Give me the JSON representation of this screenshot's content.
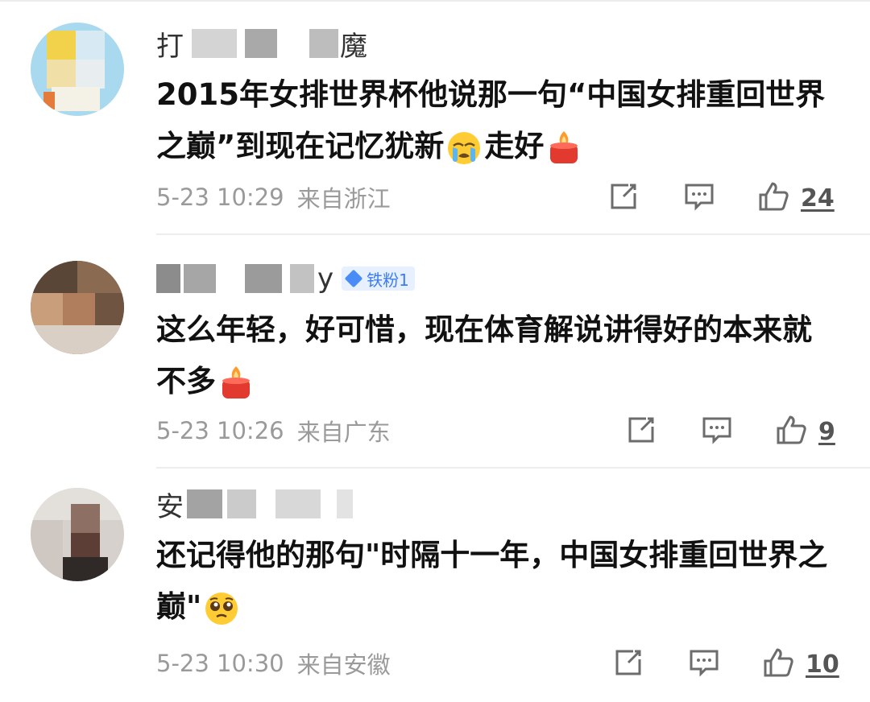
{
  "comments": [
    {
      "username_visible": [
        "打",
        "魔"
      ],
      "badge": null,
      "text": "2015年女排世界杯他说那一句“中国女排重回世界之巅”到现在记忆犹新",
      "text_tail": "走好",
      "emojis": [
        "crying-face-emoji",
        "candle-emoji"
      ],
      "time": "5-23 10:29",
      "location": "来自浙江",
      "likes": "24"
    },
    {
      "username_visible": [
        "y"
      ],
      "badge": "铁粉1",
      "text": "这么年轻，好可惜，现在体育解说讲得好的本来就不多",
      "emojis": [
        "candle-emoji"
      ],
      "time": "5-23 10:26",
      "location": "来自广东",
      "likes": "9"
    },
    {
      "username_visible": [
        "安"
      ],
      "badge": null,
      "text": "还记得他的那句\"时隔十一年，中国女排重回世界之巅\"",
      "emojis": [
        "pleading-face-emoji"
      ],
      "time": "5-23 10:30",
      "location": "来自安徽",
      "likes": "10"
    }
  ],
  "icons": {
    "repost": "repost-icon",
    "comment": "comment-icon",
    "like": "thumbs-up-icon"
  },
  "colors": {
    "meta_text": "#9a9a9a",
    "badge_bg": "#e6f0ff",
    "badge_text": "#3c7cf0",
    "divider": "#ededed"
  }
}
